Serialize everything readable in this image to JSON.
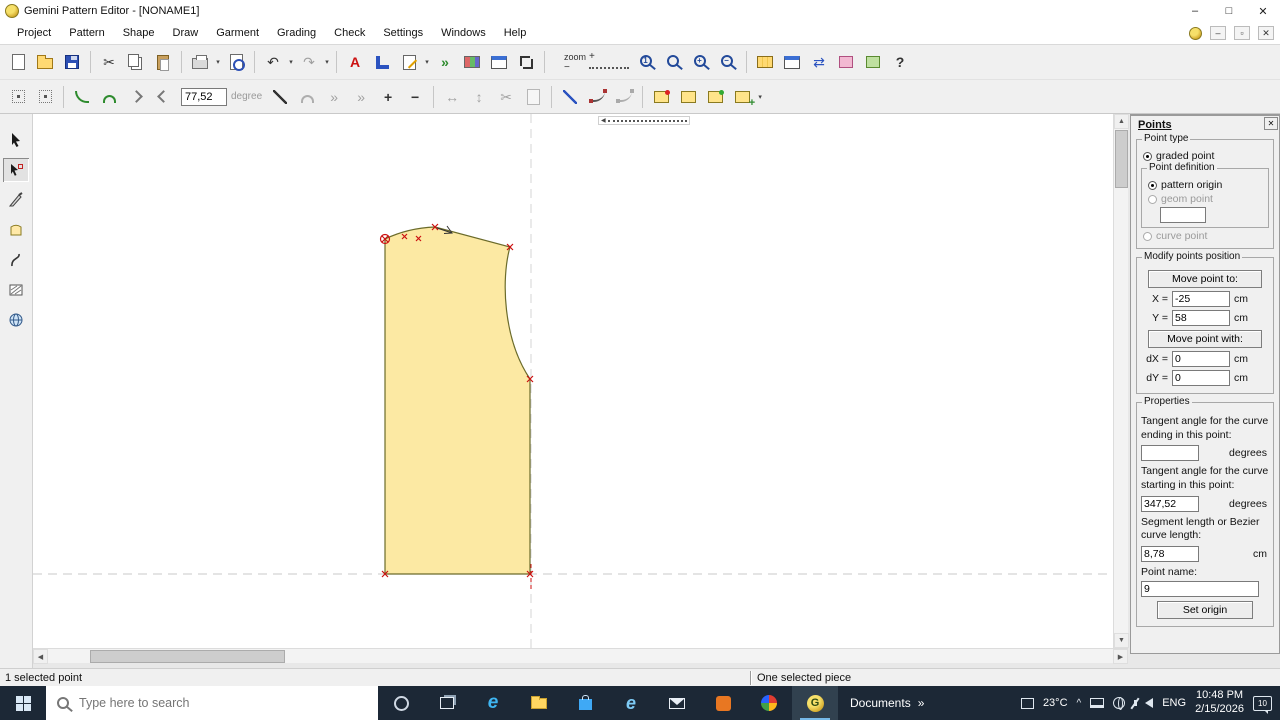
{
  "titlebar": {
    "title": "Gemini Pattern Editor - [NONAME1]",
    "minimize": "–",
    "maximize": "□",
    "close": "✕"
  },
  "menu": {
    "items": [
      "Project",
      "Pattern",
      "Shape",
      "Draw",
      "Garment",
      "Grading",
      "Check",
      "Settings",
      "Windows",
      "Help"
    ],
    "minimize": "–",
    "restore": "▫",
    "close": "✕"
  },
  "glyphs": {
    "dropdown": "▾",
    "undo": "↶",
    "redo": "↷",
    "scissors": "✂",
    "text_tool": "A",
    "run": "»",
    "swap_arrows": "⇄",
    "help": "?",
    "plus": "+",
    "minus": "−",
    "mag_one": "1",
    "mag_plus": "+",
    "mag_minus": "−",
    "mag_none": "",
    "measure_h": "↔",
    "measure_v": "↕",
    "chevron_left": "◀",
    "chevron_right": "▶",
    "chevron_up": "▲",
    "chevron_down": "▼",
    "caret": "^",
    "overflow": "»",
    "edge_letter": "e",
    "ie_letter": "e",
    "gemini_letter": "G"
  },
  "toolbar1": {
    "zoom_label": "zoom"
  },
  "toolbar2": {
    "angle_value": "77,52",
    "angle_unit": "degree"
  },
  "panel": {
    "title": "Points",
    "close": "✕",
    "point_type": {
      "legend": "Point type",
      "graded": "graded point",
      "definition_legend": "Point definition",
      "pattern_origin": "pattern origin",
      "geom_point": "geom point",
      "geom_value": "",
      "curve_point": "curve point"
    },
    "modify": {
      "legend": "Modify points position",
      "move_to": "Move point to:",
      "x_label": "X =",
      "x_value": "-25",
      "x_unit": "cm",
      "y_label": "Y =",
      "y_value": "58",
      "y_unit": "cm",
      "move_with": "Move point with:",
      "dx_label": "dX =",
      "dx_value": "0",
      "dx_unit": "cm",
      "dy_label": "dY =",
      "dy_value": "0",
      "dy_unit": "cm"
    },
    "properties": {
      "legend": "Properties",
      "tangent_end_label": "Tangent angle for the curve ending in this point:",
      "tangent_end_value": "",
      "tangent_end_unit": "degrees",
      "tangent_start_label": "Tangent angle for the curve starting in this point:",
      "tangent_start_value": "347,52",
      "tangent_start_unit": "degrees",
      "segment_label": "Segment length or Bezier curve length:",
      "segment_value": "8,78",
      "segment_unit": "cm",
      "point_name_label": "Point name:",
      "point_name_value": "9",
      "set_origin": "Set origin"
    }
  },
  "statusbar": {
    "left": "1 selected point",
    "middle": "One selected piece"
  },
  "taskbar": {
    "search_placeholder": "Type here to search",
    "documents": "Documents",
    "temperature": "23°C",
    "language": "ENG",
    "time": "10:48 PM",
    "date": "2/15/2026",
    "badge": "10"
  },
  "colors": {
    "piece_fill": "#fce9a3",
    "piece_outline": "#6b6b2a",
    "marker_red": "#cc1111",
    "taskbar_bg": "#1c2836",
    "accent_blue": "#2b53c0"
  }
}
